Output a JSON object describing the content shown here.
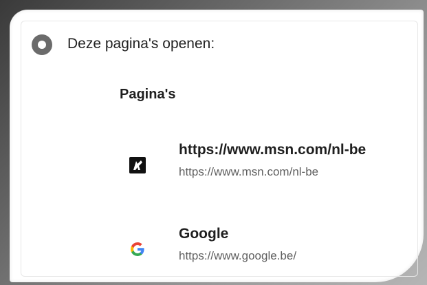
{
  "startup": {
    "option_label": "Deze pagina's openen:",
    "section_title": "Pagina's",
    "pages": [
      {
        "title": "https://www.msn.com/nl-be",
        "url": "https://www.msn.com/nl-be",
        "icon": "msn-icon"
      },
      {
        "title": "Google",
        "url": "https://www.google.be/",
        "icon": "google-icon"
      }
    ]
  },
  "colors": {
    "radio": "#6b6b6b",
    "text_primary": "#1f1f1f",
    "text_secondary": "#5f5f5f",
    "google_blue": "#4285F4",
    "google_red": "#EA4335",
    "google_yellow": "#FBBC05",
    "google_green": "#34A853"
  }
}
